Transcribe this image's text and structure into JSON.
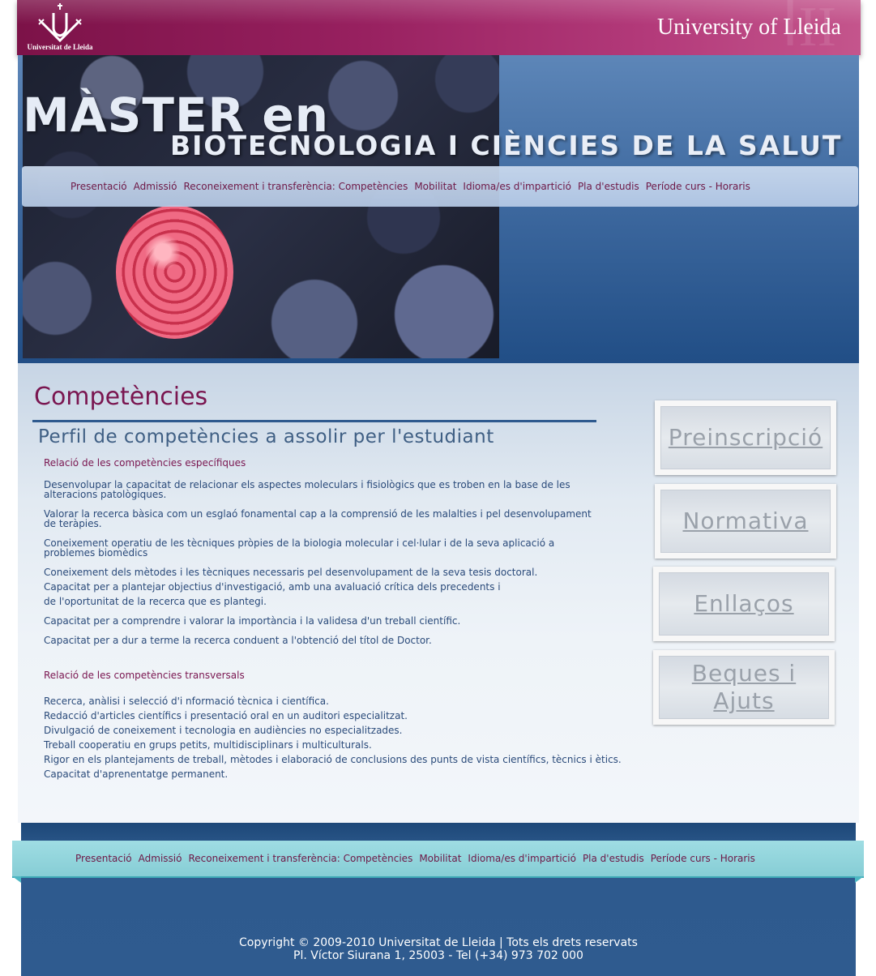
{
  "header": {
    "logo_text": "Universitat de Lleida",
    "university_name": "University of Lleida",
    "title_line1": "MÀSTER en",
    "title_line2": "BIOTECNOLOGIA I CIÈNCIES DE LA SALUT"
  },
  "nav": {
    "items": [
      "Presentació",
      "Admissió",
      "Reconeixement i transferència: Competències",
      "Mobilitat",
      "Idioma/es d'impartició",
      "Pla d'estudis",
      " Període curs - Horaris"
    ]
  },
  "main": {
    "title": "Competències",
    "subtitle": "Perfil de competències a assolir per l'estudiant",
    "specific_heading": "Relació de les competències específiques",
    "specific_items": [
      "Desenvolupar la capacitat de relacionar els aspectes moleculars i fisiològics que es troben en la base de les\nalteracions patològiques.",
      "Valorar la recerca bàsica com un esglaó fonamental cap a la comprensió de les malalties i pel desenvolupament\n de teràpies.",
      "Coneixement operatiu de les tècniques pròpies de la biologia molecular i cel·lular i de la seva aplicació a\nproblemes biomèdics",
      "Coneixement dels mètodes i les tècniques necessaris pel desenvolupament de la seva tesis doctoral.",
      "Capacitat per a plantejar objectius d'investigació, amb una avaluació crítica dels precedents i",
      "de l'oportunitat de la recerca que es plantegi.",
      "Capacitat per a comprendre i valorar la importància i la validesa d'un treball científic.",
      "Capacitat per a dur a terme la recerca conduent a l'obtenció del títol de Doctor."
    ],
    "transversal_heading": "Relació de les competències transversals",
    "transversal_items": [
      "Recerca, anàlisi i selecció d'i nformació tècnica i científica.",
      "Redacció d'articles científics i  presentació oral en un auditori especialitzat.",
      "Divulgació de coneixement i tecnologia en audiències no especialitzades.",
      "Treball cooperatiu en grups petits,   multidisciplinars i multiculturals.",
      "Rigor en els plantejaments de treball, mètodes i elaboració de conclusions des punts de vista científics, tècnics i ètics.",
      "Capacitat d'aprenentatge permanent."
    ]
  },
  "sidebar": {
    "buttons": [
      "Preinscripció",
      "Normativa",
      "Enllaços",
      "Beques i Ajuts"
    ]
  },
  "footer": {
    "copyright": "Copyright © 2009-2010  Universitat de Lleida | Tots els drets reservats",
    "address": "Pl. Víctor Siurana 1, 25003 - Tel (+34) 973 702 000"
  },
  "colors": {
    "brand_magenta": "#7a1650",
    "banner_blue": "#2f5b8f",
    "footer_nav_teal": "#8fd3da"
  }
}
